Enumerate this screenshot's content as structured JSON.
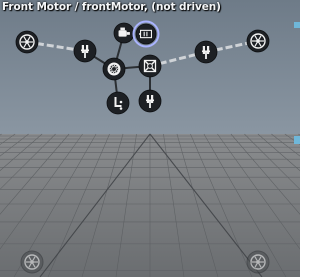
{
  "viewport": {
    "title": "Front Motor / frontMotor, (not driven)"
  },
  "colors": {
    "sky": "#7b8794",
    "ground": "#747779",
    "node_fill": "#1d2024",
    "node_icon": "#f2f2f2",
    "link": "#cfd3d7",
    "selected_ring": "#aab4ff",
    "edge_accent": "#6fb7d9"
  },
  "graph": {
    "nodes": [
      {
        "id": "wheel-front-left",
        "icon": "wheel-icon"
      },
      {
        "id": "shock-front-left",
        "icon": "suspension-icon"
      },
      {
        "id": "front-motor",
        "icon": "motor-icon"
      },
      {
        "id": "front-motor-socket",
        "icon": "battery-icon",
        "selected": true
      },
      {
        "id": "differential",
        "icon": "differential-icon"
      },
      {
        "id": "gearbox",
        "icon": "gearbox-icon"
      },
      {
        "id": "shock-front-right",
        "icon": "suspension-icon"
      },
      {
        "id": "wheel-front-right",
        "icon": "wheel-icon"
      },
      {
        "id": "driveshaft-rear",
        "icon": "gear-shift-icon"
      },
      {
        "id": "shock-center",
        "icon": "suspension-icon"
      }
    ],
    "ground_wheels": [
      {
        "id": "wheel-rear-left",
        "icon": "wheel-icon"
      },
      {
        "id": "wheel-rear-right",
        "icon": "wheel-icon"
      }
    ]
  }
}
